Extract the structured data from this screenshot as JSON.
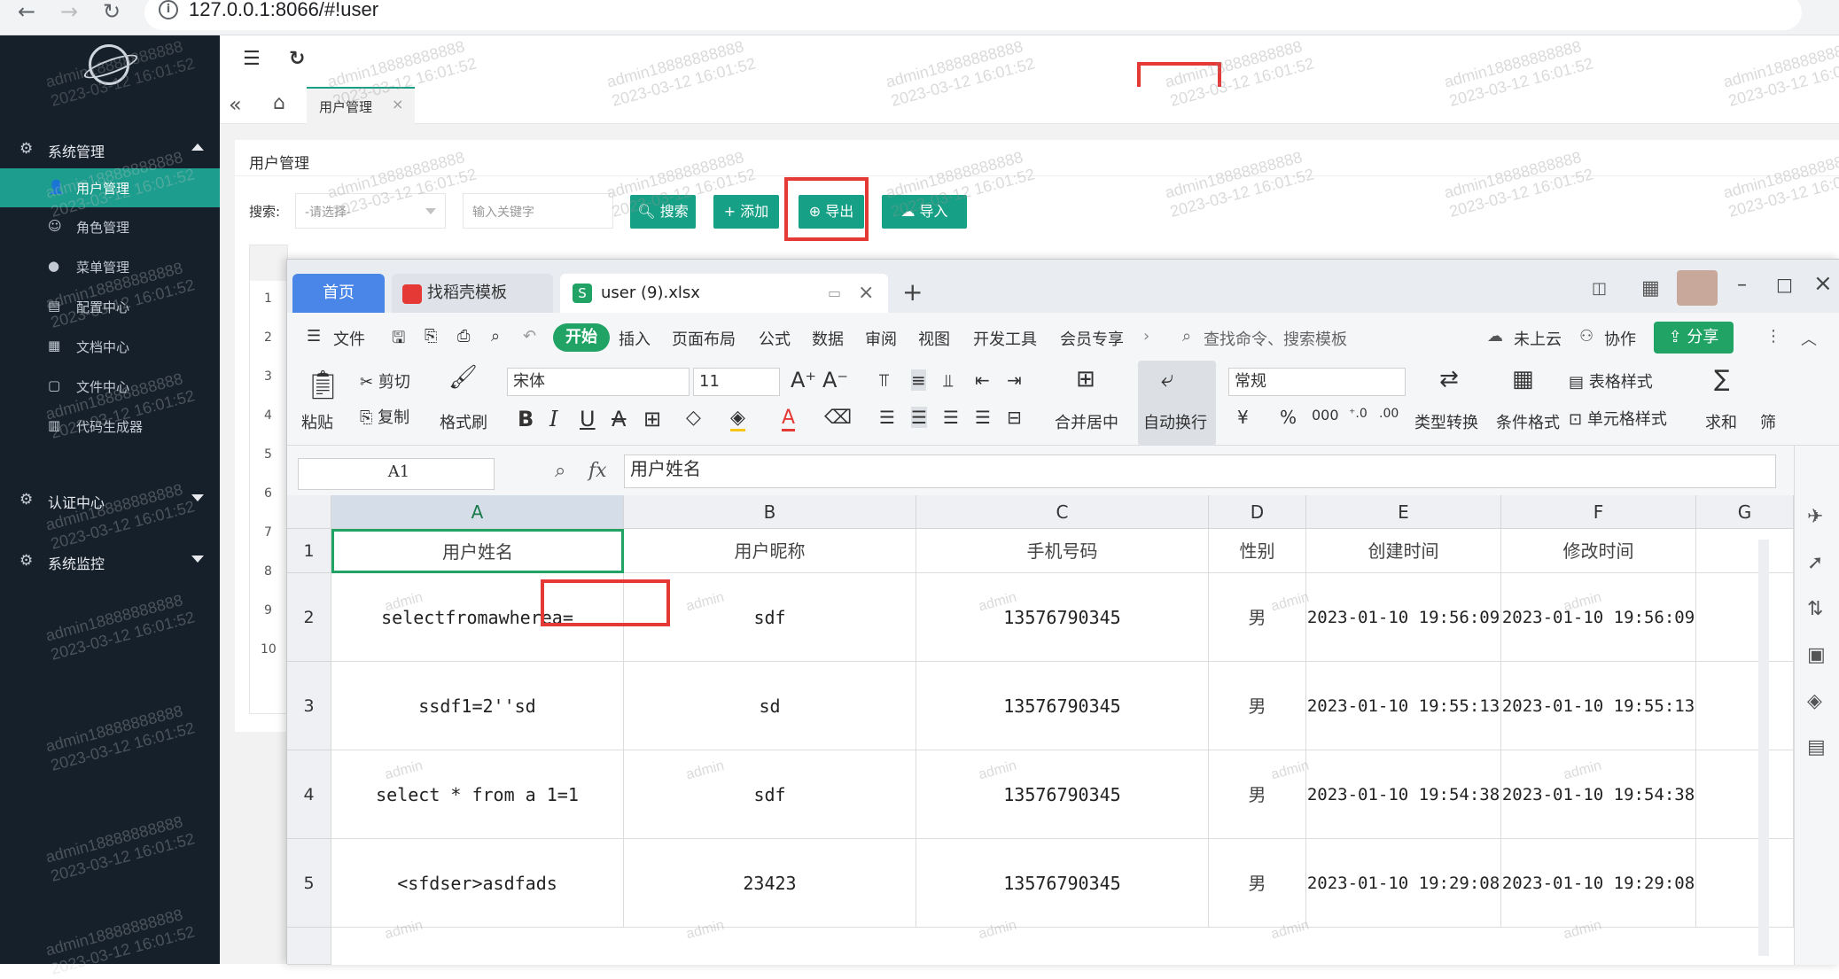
{
  "browser": {
    "url": "127.0.0.1:8066/#!user",
    "info": "i",
    "back": "←",
    "forward": "→",
    "reload": "↻"
  },
  "sidebar": {
    "groups": [
      {
        "icon": "⚙",
        "label": "系统管理"
      },
      {
        "icon": "⚙",
        "label": "认证中心"
      },
      {
        "icon": "⚙",
        "label": "系统监控"
      }
    ],
    "items": [
      {
        "icon": "👤",
        "label": "用户管理"
      },
      {
        "icon": "☺",
        "label": "角色管理"
      },
      {
        "icon": "●",
        "label": "菜单管理"
      },
      {
        "icon": "▤",
        "label": "配置中心"
      },
      {
        "icon": "▦",
        "label": "文档中心"
      },
      {
        "icon": "▢",
        "label": "文件中心"
      },
      {
        "icon": "▥",
        "label": "代码生成器"
      }
    ]
  },
  "header": {
    "menu_icon": "☰",
    "refresh_icon": "↻"
  },
  "tabs": {
    "collapse": "«",
    "home": "⌂",
    "active_tab": "用户管理",
    "close": "×"
  },
  "page": {
    "title": "用户管理",
    "search_label": "搜索:",
    "select_placeholder": "-请选择-",
    "keyword_placeholder": "输入关键字",
    "buttons": {
      "search": "搜索",
      "add": "添加",
      "export": "导出",
      "import": "导入"
    },
    "row_numbers": [
      "1",
      "2",
      "3",
      "4",
      "5",
      "6",
      "7",
      "8",
      "9",
      "10"
    ]
  },
  "watermark": {
    "user": "admin18888888888",
    "time": "2023-03-12 16:01:52",
    "cell_mark": "admin"
  },
  "wps": {
    "tabs": {
      "home": "首页",
      "template": "找稻壳模板",
      "file": "user (9).xlsx",
      "new": "+"
    },
    "menu": [
      "文件",
      "开始",
      "插入",
      "页面布局",
      "公式",
      "数据",
      "审阅",
      "视图",
      "开发工具",
      "会员专享"
    ],
    "search": "查找命令、搜索模板",
    "cloud": "未上云",
    "collab": "协作",
    "share": "分享",
    "toolbar": {
      "paste": "粘贴",
      "cut": "剪切",
      "copy": "复制",
      "format_painter": "格式刷",
      "font": "宋体",
      "size": "11",
      "merge": "合并居中",
      "wrap": "自动换行",
      "number_format": "常规",
      "type_convert": "类型转换",
      "cond_format": "条件格式",
      "table_style": "表格样式",
      "cell_style": "单元格样式",
      "sum": "求和",
      "filter": "筛"
    },
    "namebox": "A1",
    "fx": "fx",
    "formula": "用户姓名",
    "columns": [
      "A",
      "B",
      "C",
      "D",
      "E",
      "F",
      "G"
    ],
    "rows": [
      {
        "num": "1",
        "cells": [
          "用户姓名",
          "用户昵称",
          "手机号码",
          "性别",
          "创建时间",
          "修改时间"
        ]
      },
      {
        "num": "2",
        "cells": [
          "selectfromawherea=",
          "sdf",
          "13576790345",
          "男",
          "2023-01-10 19:56:09",
          "2023-01-10 19:56:09"
        ]
      },
      {
        "num": "3",
        "cells": [
          "ssdf1=2''sd",
          "sd",
          "13576790345",
          "男",
          "2023-01-10 19:55:13",
          "2023-01-10 19:55:13"
        ]
      },
      {
        "num": "4",
        "cells": [
          "select * from a 1=1",
          "sdf",
          "13576790345",
          "男",
          "2023-01-10 19:54:38",
          "2023-01-10 19:54:38"
        ]
      },
      {
        "num": "5",
        "cells": [
          "<sfdser>asdfads",
          "23423",
          "13576790345",
          "男",
          "2023-01-10 19:29:08",
          "2023-01-10 19:29:08"
        ]
      }
    ]
  },
  "colors": {
    "sidebar": "#15202b",
    "accent": "#16a085",
    "active_item": "#1c9d8d",
    "highlight": "#e53935",
    "wps_tab": "#4a86e8",
    "share": "#21a366"
  }
}
